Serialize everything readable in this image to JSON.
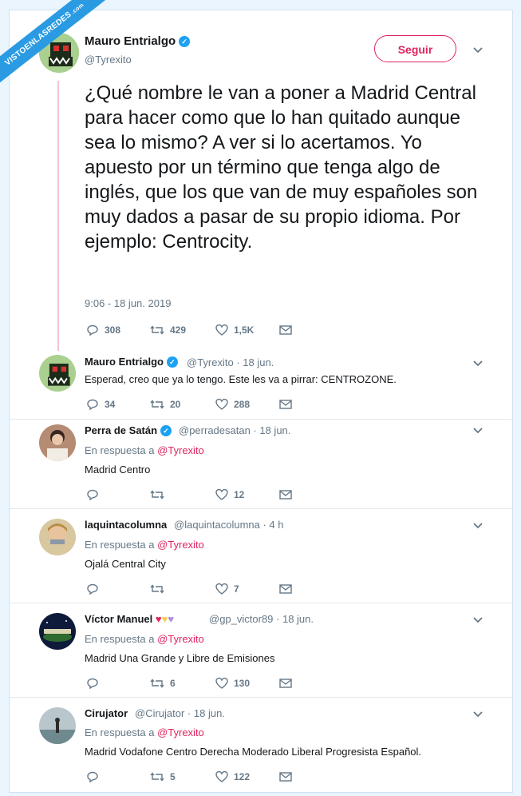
{
  "watermark": {
    "text": "VISTOENLASREDES",
    "suffix": ".com"
  },
  "main_tweet": {
    "author": "Mauro Entrialgo",
    "handle": "@Tyrexito",
    "follow_label": "Seguir",
    "text": "¿Qué nombre le van a poner a Madrid Central para hacer como que lo han quitado aunque sea lo mismo? A ver si lo acertamos. Yo apuesto por un término que tenga algo de inglés, que los que van de muy españoles son muy dados a pasar de su propio idioma. Por ejemplo: Centrocity.",
    "timestamp": "9:06 - 18 jun. 2019",
    "replies": "308",
    "retweets": "429",
    "likes": "1,5K"
  },
  "tweets": [
    {
      "author": "Mauro Entrialgo",
      "handle": "@Tyrexito · 18 jun.",
      "reply_to_label": "",
      "reply_to": "",
      "text": "Esperad, creo que ya lo tengo. Este les va a pirrar: CENTROZONE.",
      "replies": "34",
      "retweets": "20",
      "likes": "288"
    },
    {
      "author": "Perra de Satán",
      "handle": "@perradesatan · 18 jun.",
      "reply_to_label": "En respuesta a",
      "reply_to": "@Tyrexito",
      "text": "Madrid Centro",
      "replies": "",
      "retweets": "",
      "likes": "12"
    },
    {
      "author": "laquintacolumna",
      "handle": "@laquintacolumna · 4 h",
      "reply_to_label": "En respuesta a",
      "reply_to": "@Tyrexito",
      "text": "Ojalá Central City",
      "replies": "",
      "retweets": "",
      "likes": "7"
    },
    {
      "author": "Víctor Manuel",
      "handle": "@gp_victor89 · 18 jun.",
      "reply_to_label": "En respuesta a",
      "reply_to": "@Tyrexito",
      "text": "Madrid Una Grande y Libre de Emisiones",
      "replies": "",
      "retweets": "6",
      "likes": "130"
    },
    {
      "author": "Cirujator",
      "handle": "@Cirujator · 18 jun.",
      "reply_to_label": "En respuesta a",
      "reply_to": "@Tyrexito",
      "text": "Madrid Vodafone Centro Derecha Moderado Liberal Progresista Español.",
      "replies": "",
      "retweets": "5",
      "likes": "122"
    }
  ],
  "icons": {
    "reply": "reply-icon",
    "retweet": "retweet-icon",
    "like": "heart-icon",
    "dm": "envelope-icon",
    "verified": "verified-badge-icon",
    "more": "chevron-down-icon"
  },
  "colors": {
    "accent": "#e0245e",
    "verified": "#1da1f2",
    "muted": "#657786",
    "watermark": "#2a9be2"
  }
}
